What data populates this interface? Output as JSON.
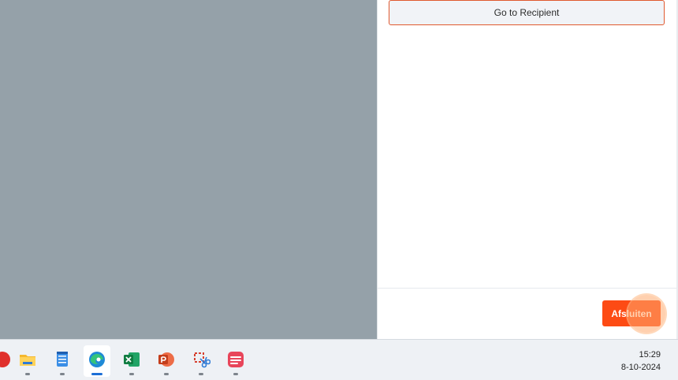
{
  "panel": {
    "goto_button_label": "Go to Recipient",
    "close_button_label": "Afsluiten",
    "accent_color": "#fd4b14"
  },
  "taskbar": {
    "apps": [
      {
        "icon": "app-partial-icon"
      },
      {
        "icon": "file-explorer-icon"
      },
      {
        "icon": "notepad-icon"
      },
      {
        "icon": "edge-browser-icon",
        "active": true
      },
      {
        "icon": "excel-icon"
      },
      {
        "icon": "powerpoint-icon"
      },
      {
        "icon": "snipping-tool-icon"
      },
      {
        "icon": "whiteboard-app-icon"
      }
    ],
    "clock": {
      "time": "15:29",
      "date": "8-10-2024"
    }
  }
}
